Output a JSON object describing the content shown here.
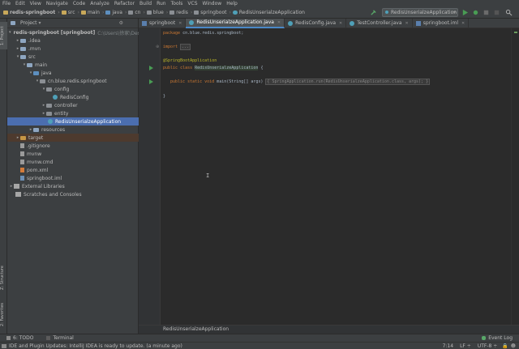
{
  "menu": [
    "File",
    "Edit",
    "View",
    "Navigate",
    "Code",
    "Analyze",
    "Refactor",
    "Build",
    "Run",
    "Tools",
    "VCS",
    "Window",
    "Help"
  ],
  "nav": {
    "project": "redis-springboot",
    "crumbs": [
      "src",
      "main",
      "java",
      "cn",
      "blue",
      "redis",
      "springboot",
      "RedisUnserialzeApplication"
    ],
    "run_config": "RedisUnserialzeApplication"
  },
  "left_strip": {
    "project": "1: Project",
    "structure": "Z: Structure",
    "favorites": "2: Favorites"
  },
  "project_panel": {
    "title": "Project",
    "tree": [
      {
        "label": "redis-springboot [springboot]",
        "hint": "C:\\Users\\徐家\\Deskt",
        "icon": "module"
      },
      {
        "label": ".idea",
        "icon": "folder"
      },
      {
        "label": ".mvn",
        "icon": "folder"
      },
      {
        "label": "src",
        "icon": "folder"
      },
      {
        "label": "main",
        "icon": "folder"
      },
      {
        "label": "java",
        "icon": "src"
      },
      {
        "label": "cn.blue.redis.springboot",
        "icon": "package"
      },
      {
        "label": "config",
        "icon": "package"
      },
      {
        "label": "RedisConfig",
        "icon": "class"
      },
      {
        "label": "controller",
        "icon": "package"
      },
      {
        "label": "entity",
        "icon": "package"
      },
      {
        "label": "RedisUnserialzeApplication",
        "icon": "class",
        "selected": true
      },
      {
        "label": "resources",
        "icon": "folder"
      },
      {
        "label": "target",
        "icon": "excluded"
      },
      {
        "label": ".gitignore",
        "icon": "file"
      },
      {
        "label": "mvnw",
        "icon": "file"
      },
      {
        "label": "mvnw.cmd",
        "icon": "file"
      },
      {
        "label": "pom.xml",
        "icon": "xml"
      },
      {
        "label": "springboot.iml",
        "icon": "iml"
      },
      {
        "label": "External Libraries",
        "icon": "lib"
      },
      {
        "label": "Scratches and Consoles",
        "icon": "lib"
      }
    ]
  },
  "tabs": [
    {
      "label": "springboot",
      "icon": "module"
    },
    {
      "label": "RedisUnserialzeApplication.java",
      "icon": "class",
      "active": true
    },
    {
      "label": "RedisConfig.java",
      "icon": "class"
    },
    {
      "label": "TestController.java",
      "icon": "class"
    },
    {
      "label": "springboot.iml",
      "icon": "module"
    }
  ],
  "code": {
    "package_kw": "package",
    "package_name": "cn.blue.redis.springboot;",
    "import_kw": "import",
    "import_fold": "...",
    "annotation": "@SpringBootApplication",
    "class_kw": "public class",
    "class_name": "RedisUnserialzeApplication",
    "class_open": "{",
    "main_kw": "public static void",
    "main_sig": "main(String[] args)",
    "main_body": "{ SpringApplication.run(RedisUnserialzeApplication.class, args); }",
    "close": "}"
  },
  "editor_breadcrumb": "RedisUnserialzeApplication",
  "bottom_tabs": [
    "6: TODO",
    "Terminal"
  ],
  "event_log": "Event Log",
  "status": {
    "message": "IDE and Plugin Updates: IntelliJ IDEA is ready to update. (a minute ago)",
    "position": "7:14",
    "line_sep": "LF ÷",
    "encoding": "UTF-8 ÷"
  },
  "colors": {
    "selection": "#4b6eaf",
    "accent": "#4a88c7",
    "run": "#499c54"
  }
}
